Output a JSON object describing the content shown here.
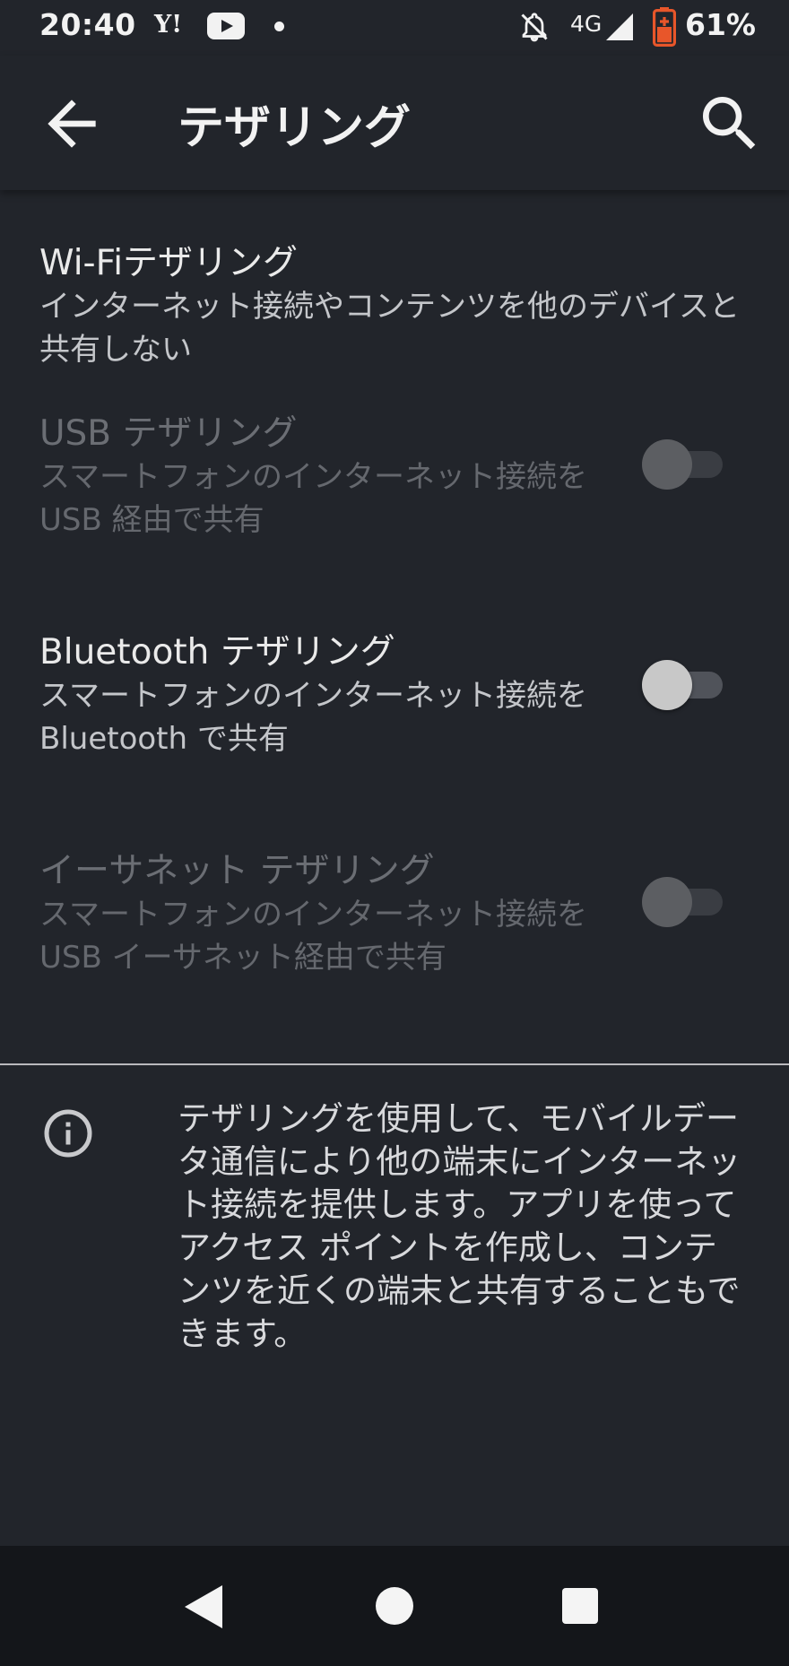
{
  "status_bar": {
    "time": "20:40",
    "yahoo_label": "Y!",
    "network": "4G",
    "battery": "61%",
    "icons": [
      "yahoo-icon",
      "youtube-icon",
      "notification-dot-icon",
      "notifications-off-icon",
      "signal-icon",
      "battery-saver-icon"
    ],
    "battery_color": "#e8562a"
  },
  "app_bar": {
    "title": "テザリング",
    "back_icon": "arrow-back-icon",
    "search_icon": "search-icon"
  },
  "preferences": [
    {
      "title": "Wi-Fiテザリング",
      "summary": "インターネット接続やコンテンツを他のデバイスと共有しない",
      "enabled": true,
      "has_toggle": false
    },
    {
      "title": "USB テザリング",
      "summary": "スマートフォンのインターネット接続を USB 経由で共有",
      "enabled": false,
      "has_toggle": true,
      "checked": false
    },
    {
      "title": "Bluetooth テザリング",
      "summary": "スマートフォンのインターネット接続を Bluetooth で共有",
      "enabled": true,
      "has_toggle": true,
      "checked": false
    },
    {
      "title": "イーサネット テザリング",
      "summary": "スマートフォンのインターネット接続を USB イーサネット経由で共有",
      "enabled": false,
      "has_toggle": true,
      "checked": false
    }
  ],
  "footer_info": {
    "icon": "info-icon",
    "text": "テザリングを使用して、モバイルデータ通信により他の端末にインターネット接続を提供します。アプリを使ってアクセス ポイントを作成し、コンテンツを近くの端末と共有することもできます。"
  },
  "nav_bar": {
    "icons": [
      "nav-back-icon",
      "nav-home-icon",
      "nav-recents-icon"
    ]
  },
  "colors": {
    "background": "#22252b",
    "nav_background": "#14161a",
    "text_primary": "#eaeaea",
    "text_disabled": "#6b6e74"
  }
}
